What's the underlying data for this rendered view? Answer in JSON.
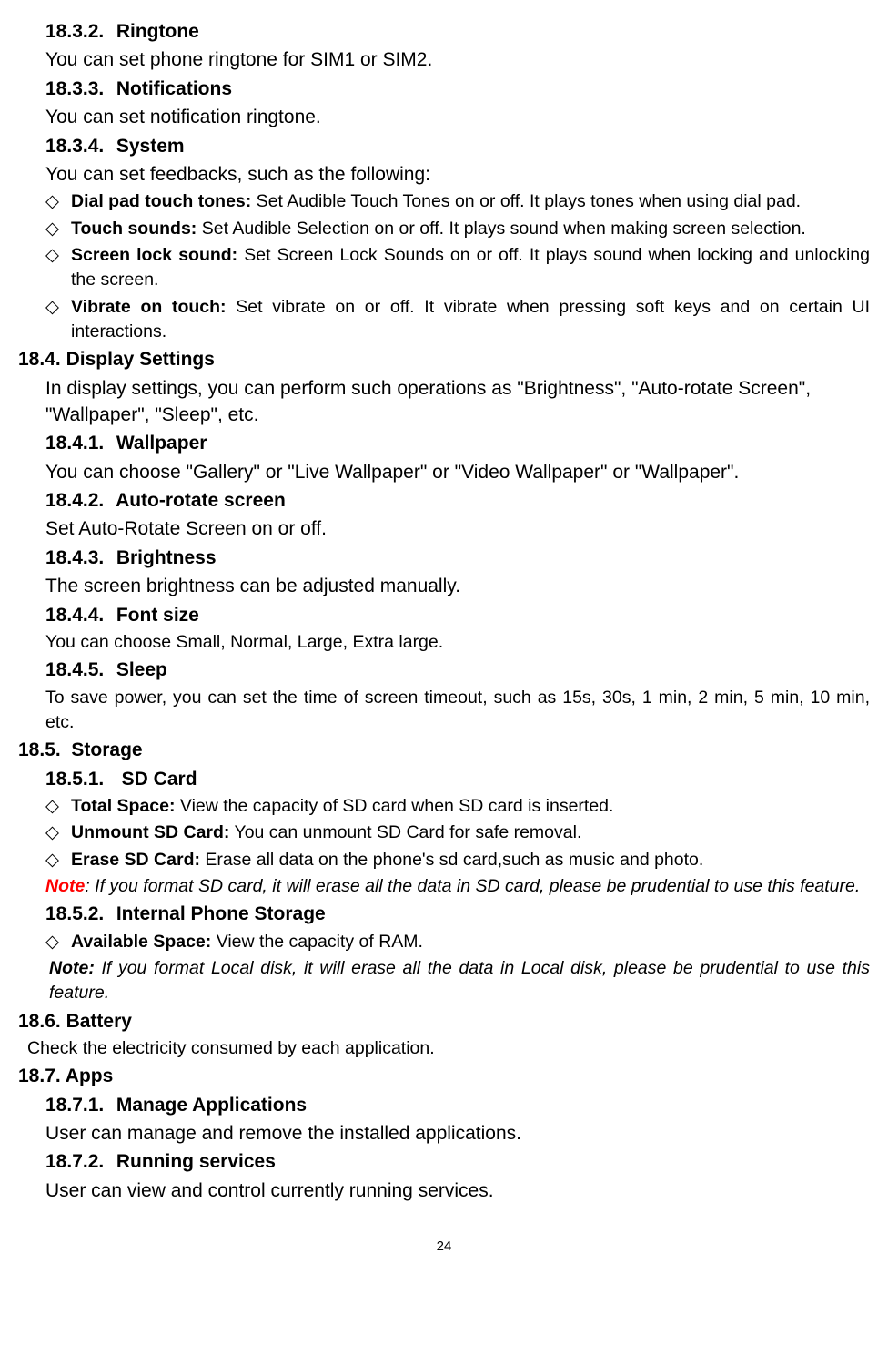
{
  "s1832": {
    "num": "18.3.2.",
    "title": "Ringtone",
    "body": "You can set phone ringtone for SIM1 or SIM2."
  },
  "s1833": {
    "num": "18.3.3.",
    "title": "Notifications",
    "body": "You can set notification ringtone."
  },
  "s1834": {
    "num": "18.3.4.",
    "title": "System",
    "body": "You can set feedbacks, such as the following:"
  },
  "syslist": [
    {
      "label": "Dial pad touch tones:",
      "text": " Set Audible Touch Tones on or off. It plays tones when using dial pad."
    },
    {
      "label": "Touch sounds:",
      "text": " Set Audible Selection on or off. It plays sound when making screen selection."
    },
    {
      "label": "Screen lock sound:",
      "text": " Set Screen Lock Sounds on or off. It plays sound when locking and unlocking the screen."
    },
    {
      "label": "Vibrate on touch:",
      "text": " Set vibrate on or off. It vibrate when pressing soft keys and on certain UI interactions."
    }
  ],
  "s184": {
    "num": "18.4.",
    "title": "Display Settings",
    "body": "In display settings, you can perform such operations as \"Brightness\", \"Auto-rotate Screen\", \"Wallpaper\", \"Sleep\", etc."
  },
  "s1841": {
    "num": "18.4.1.",
    "title": "Wallpaper",
    "body": "You can choose \"Gallery\" or \"Live Wallpaper\" or \"Video Wallpaper\" or \"Wallpaper\"."
  },
  "s1842": {
    "num": "18.4.2.",
    "title": "Auto-rotate screen",
    "body": "Set Auto-Rotate Screen on or off."
  },
  "s1843": {
    "num": "18.4.3.",
    "title": "Brightness",
    "body": "The screen brightness can be adjusted manually."
  },
  "s1844": {
    "num": "18.4.4.",
    "title": "Font size",
    "body": "You can choose Small, Normal, Large, Extra large."
  },
  "s1845": {
    "num": "18.4.5.",
    "title": "Sleep",
    "body": "To save power, you can set the time of screen timeout, such as 15s, 30s, 1 min, 2 min, 5 min, 10 min, etc."
  },
  "s185": {
    "num": "18.5.",
    "title": "Storage"
  },
  "s1851": {
    "num": "18.5.1.",
    "title": "SD Card"
  },
  "sdlist": [
    {
      "label": "Total Space:",
      "text": " View the capacity of SD card when SD card is inserted."
    },
    {
      "label": "Unmount SD Card:",
      "text": " You can unmount SD Card for safe removal."
    },
    {
      "label": "Erase SD Card:",
      "text": " Erase all data on the phone's sd card,such as music and photo."
    }
  ],
  "note1": {
    "prefix": "Note",
    "text": ": If you format SD card, it will erase all the data in SD card, please be prudential to use this feature."
  },
  "s1852": {
    "num": "18.5.2.",
    "title": "Internal Phone Storage"
  },
  "ipslist": [
    {
      "label": "Available Space:",
      "text": " View the capacity of RAM."
    }
  ],
  "note2": {
    "prefix": "Note:",
    "text": " If you format Local disk, it will erase all the data in Local disk, please be prudential to use this feature."
  },
  "s186": {
    "num": "18.6.",
    "title": "Battery",
    "body": "Check the electricity consumed by each application."
  },
  "s187": {
    "num": "18.7.",
    "title": "Apps"
  },
  "s1871": {
    "num": "18.7.1.",
    "title": "Manage Applications",
    "body": "User can manage and remove the installed applications."
  },
  "s1872": {
    "num": "18.7.2.",
    "title": "Running services",
    "body": "User can view and control currently running services."
  },
  "pagenum": "24",
  "diamond": "◇"
}
